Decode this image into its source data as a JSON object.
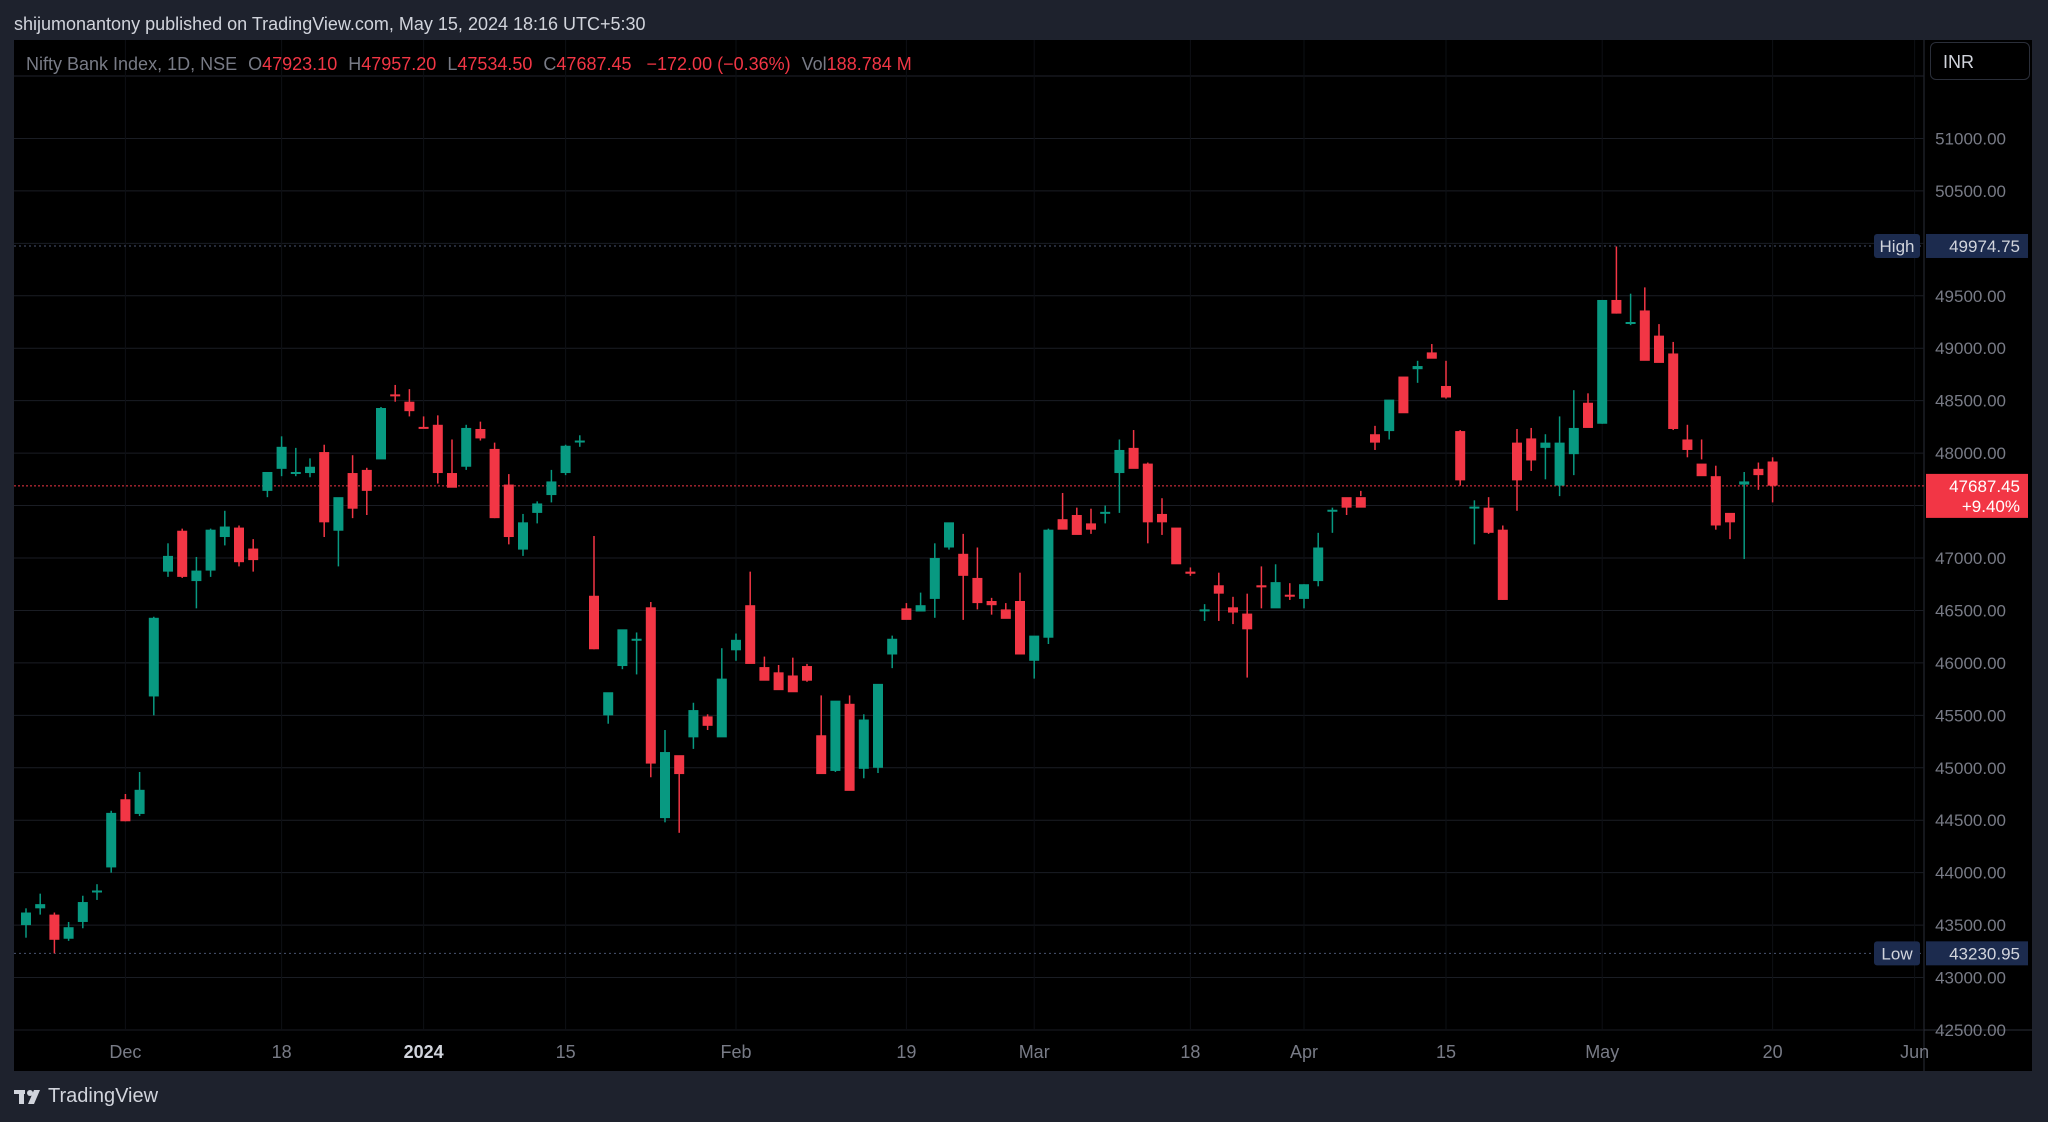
{
  "header": {
    "published": "shijumonantony published on TradingView.com, May 15, 2024 18:16 UTC+5:30"
  },
  "legend": {
    "symbol": "Nifty Bank Index, 1D, NSE",
    "o_label": "O",
    "o": "47923.10",
    "h_label": "H",
    "h": "47957.20",
    "l_label": "L",
    "l": "47534.50",
    "c_label": "C",
    "c": "47687.45",
    "change": "−172.00 (−0.36%)",
    "vol_label": "Vol",
    "vol": "188.784 M"
  },
  "currency": "INR",
  "footer": {
    "brand": "TradingView"
  },
  "colors": {
    "up": "#089981",
    "down": "#f23645",
    "bg": "#000000",
    "grid": "#1a1d24",
    "axis_text": "#787b86"
  },
  "chart_data": {
    "type": "candlestick",
    "ylim": [
      42500,
      51500
    ],
    "yticks": [
      "42500.00",
      "43000.00",
      "43500.00",
      "44000.00",
      "44500.00",
      "45000.00",
      "45500.00",
      "46000.00",
      "46500.00",
      "47000.00",
      "47500.00",
      "48000.00",
      "48500.00",
      "49000.00",
      "49500.00",
      "50000.00",
      "50500.00",
      "51000.00"
    ],
    "xticks": [
      {
        "label": "Dec",
        "index": 7,
        "bold": false
      },
      {
        "label": "18",
        "index": 18,
        "bold": false
      },
      {
        "label": "2024",
        "index": 28,
        "bold": true
      },
      {
        "label": "15",
        "index": 38,
        "bold": false
      },
      {
        "label": "Feb",
        "index": 50,
        "bold": false
      },
      {
        "label": "19",
        "index": 62,
        "bold": false
      },
      {
        "label": "Mar",
        "index": 71,
        "bold": false
      },
      {
        "label": "18",
        "index": 82,
        "bold": false
      },
      {
        "label": "Apr",
        "index": 90,
        "bold": false
      },
      {
        "label": "15",
        "index": 100,
        "bold": false
      },
      {
        "label": "May",
        "index": 111,
        "bold": false
      },
      {
        "label": "20",
        "index": 123,
        "bold": false
      },
      {
        "label": "Jun",
        "index": 133,
        "bold": false
      }
    ],
    "high_marker": {
      "label": "High",
      "value": "49974.75"
    },
    "low_marker": {
      "label": "Low",
      "value": "43230.95"
    },
    "last_price": {
      "value": "47687.45",
      "change": "+9.40%"
    },
    "candles": [
      [
        43500,
        43660,
        43380,
        43620
      ],
      [
        43660,
        43800,
        43600,
        43700
      ],
      [
        43600,
        43620,
        43230,
        43360
      ],
      [
        43370,
        43530,
        43350,
        43480
      ],
      [
        43530,
        43780,
        43470,
        43720
      ],
      [
        43820,
        43890,
        43740,
        43830
      ],
      [
        44050,
        44590,
        44000,
        44570
      ],
      [
        44700,
        44750,
        44490,
        44490
      ],
      [
        44560,
        44960,
        44540,
        44790
      ],
      [
        45680,
        46440,
        45500,
        46430
      ],
      [
        46870,
        47140,
        46820,
        47020
      ],
      [
        47260,
        47280,
        46810,
        46820
      ],
      [
        46780,
        47010,
        46520,
        46880
      ],
      [
        46880,
        47280,
        46820,
        47270
      ],
      [
        47200,
        47450,
        47120,
        47300
      ],
      [
        47290,
        47310,
        46920,
        46960
      ],
      [
        47090,
        47180,
        46870,
        46980
      ],
      [
        47640,
        47810,
        47580,
        47820
      ],
      [
        47850,
        48160,
        47780,
        48060
      ],
      [
        47820,
        48050,
        47780,
        47820
      ],
      [
        47810,
        47950,
        47770,
        47870
      ],
      [
        48010,
        48080,
        47200,
        47340
      ],
      [
        47260,
        47560,
        46920,
        47580
      ],
      [
        47810,
        47980,
        47380,
        47470
      ],
      [
        47840,
        47860,
        47410,
        47640
      ],
      [
        47940,
        48440,
        47950,
        48430
      ],
      [
        48560,
        48650,
        48490,
        48550
      ],
      [
        48490,
        48610,
        48350,
        48400
      ],
      [
        48250,
        48350,
        48240,
        48240
      ],
      [
        48270,
        48360,
        47710,
        47810
      ],
      [
        47810,
        48130,
        47700,
        47670
      ],
      [
        47870,
        48270,
        47840,
        48240
      ],
      [
        48230,
        48300,
        48120,
        48140
      ],
      [
        48040,
        48100,
        47380,
        47380
      ],
      [
        47700,
        47800,
        47130,
        47200
      ],
      [
        47080,
        47420,
        47020,
        47340
      ],
      [
        47430,
        47540,
        47330,
        47520
      ],
      [
        47600,
        47840,
        47530,
        47730
      ],
      [
        47810,
        48080,
        47790,
        48070
      ],
      [
        48120,
        48170,
        48060,
        48120
      ],
      [
        46640,
        47210,
        46130,
        46130
      ],
      [
        45500,
        45680,
        45420,
        45720
      ],
      [
        45970,
        46050,
        45940,
        46320
      ],
      [
        46230,
        46290,
        45890,
        46230
      ],
      [
        46530,
        46580,
        44910,
        45040
      ],
      [
        44520,
        45360,
        44480,
        45150
      ],
      [
        45120,
        45100,
        44380,
        44940
      ],
      [
        45290,
        45620,
        45180,
        45550
      ],
      [
        45490,
        45510,
        45360,
        45400
      ],
      [
        45290,
        46140,
        45430,
        45850
      ],
      [
        46120,
        46280,
        46020,
        46220
      ],
      [
        46550,
        46870,
        46490,
        45990
      ],
      [
        45960,
        46060,
        45890,
        45830
      ],
      [
        45910,
        45980,
        45770,
        45740
      ],
      [
        45880,
        46050,
        45850,
        45720
      ],
      [
        45970,
        45990,
        45820,
        45830
      ],
      [
        45310,
        45690,
        45120,
        44940
      ],
      [
        44970,
        45620,
        44960,
        45640
      ],
      [
        45610,
        45690,
        44870,
        44780
      ],
      [
        44990,
        45510,
        44900,
        45460
      ],
      [
        45000,
        45710,
        44950,
        45800
      ],
      [
        46080,
        46260,
        45950,
        46230
      ],
      [
        46520,
        46570,
        46510,
        46410
      ],
      [
        46490,
        46670,
        46490,
        46550
      ],
      [
        46610,
        47140,
        46430,
        47000
      ],
      [
        47100,
        47330,
        47080,
        47340
      ],
      [
        47040,
        47230,
        46410,
        46830
      ],
      [
        46810,
        47100,
        46510,
        46570
      ],
      [
        46590,
        46620,
        46460,
        46550
      ],
      [
        46510,
        46570,
        46460,
        46420
      ],
      [
        46590,
        46860,
        46150,
        46080
      ],
      [
        46020,
        46230,
        45850,
        46260
      ],
      [
        46240,
        47280,
        46180,
        47270
      ],
      [
        47370,
        47620,
        47280,
        47270
      ],
      [
        47410,
        47480,
        47280,
        47220
      ],
      [
        47330,
        47470,
        47230,
        47270
      ],
      [
        47440,
        47500,
        47330,
        47440
      ],
      [
        47810,
        48130,
        47430,
        48030
      ],
      [
        48050,
        48220,
        47860,
        47850
      ],
      [
        47900,
        47910,
        47140,
        47340
      ],
      [
        47420,
        47570,
        47220,
        47340
      ],
      [
        47290,
        47240,
        47090,
        46940
      ],
      [
        46870,
        46910,
        46830,
        46850
      ],
      [
        46510,
        46560,
        46400,
        46510
      ],
      [
        46740,
        46860,
        46400,
        46660
      ],
      [
        46530,
        46630,
        46370,
        46480
      ],
      [
        46470,
        46660,
        45860,
        46320
      ],
      [
        46740,
        46920,
        46520,
        46720
      ],
      [
        46520,
        46940,
        46640,
        46770
      ],
      [
        46650,
        46760,
        46600,
        46640
      ],
      [
        46610,
        46750,
        46520,
        46750
      ],
      [
        46780,
        47240,
        46730,
        47100
      ],
      [
        47450,
        47480,
        47240,
        47460
      ],
      [
        47580,
        47500,
        47410,
        47480
      ],
      [
        47580,
        47640,
        47590,
        47480
      ],
      [
        48180,
        48260,
        48030,
        48100
      ],
      [
        48210,
        48480,
        48130,
        48510
      ],
      [
        48730,
        48580,
        48470,
        48380
      ],
      [
        48800,
        48880,
        48670,
        48830
      ],
      [
        48960,
        49040,
        48950,
        48900
      ],
      [
        48640,
        48880,
        48520,
        48530
      ],
      [
        48210,
        48220,
        47690,
        47740
      ],
      [
        47490,
        47550,
        47130,
        47490
      ],
      [
        47480,
        47580,
        47230,
        47240
      ],
      [
        47270,
        47310,
        46600,
        46600
      ],
      [
        48100,
        48230,
        47450,
        47740
      ],
      [
        48140,
        48240,
        47830,
        47930
      ],
      [
        48050,
        48180,
        47750,
        48100
      ],
      [
        47690,
        48350,
        47590,
        48100
      ],
      [
        47990,
        48600,
        47790,
        48240
      ],
      [
        48480,
        48570,
        48280,
        48240
      ],
      [
        48280,
        49460,
        48280,
        49460
      ],
      [
        49460,
        49970,
        49330,
        49330
      ],
      [
        49250,
        49520,
        49220,
        49250
      ],
      [
        49360,
        49580,
        49030,
        48880
      ],
      [
        49120,
        49230,
        48950,
        48860
      ],
      [
        48950,
        49060,
        48220,
        48230
      ],
      [
        48130,
        48270,
        47960,
        48030
      ],
      [
        47900,
        48130,
        47940,
        47780
      ],
      [
        47780,
        47880,
        47270,
        47310
      ],
      [
        47430,
        47390,
        47180,
        47340
      ],
      [
        47700,
        47820,
        46990,
        47730
      ],
      [
        47850,
        47910,
        47650,
        47790
      ],
      [
        47920,
        47960,
        47530,
        47690
      ]
    ]
  }
}
